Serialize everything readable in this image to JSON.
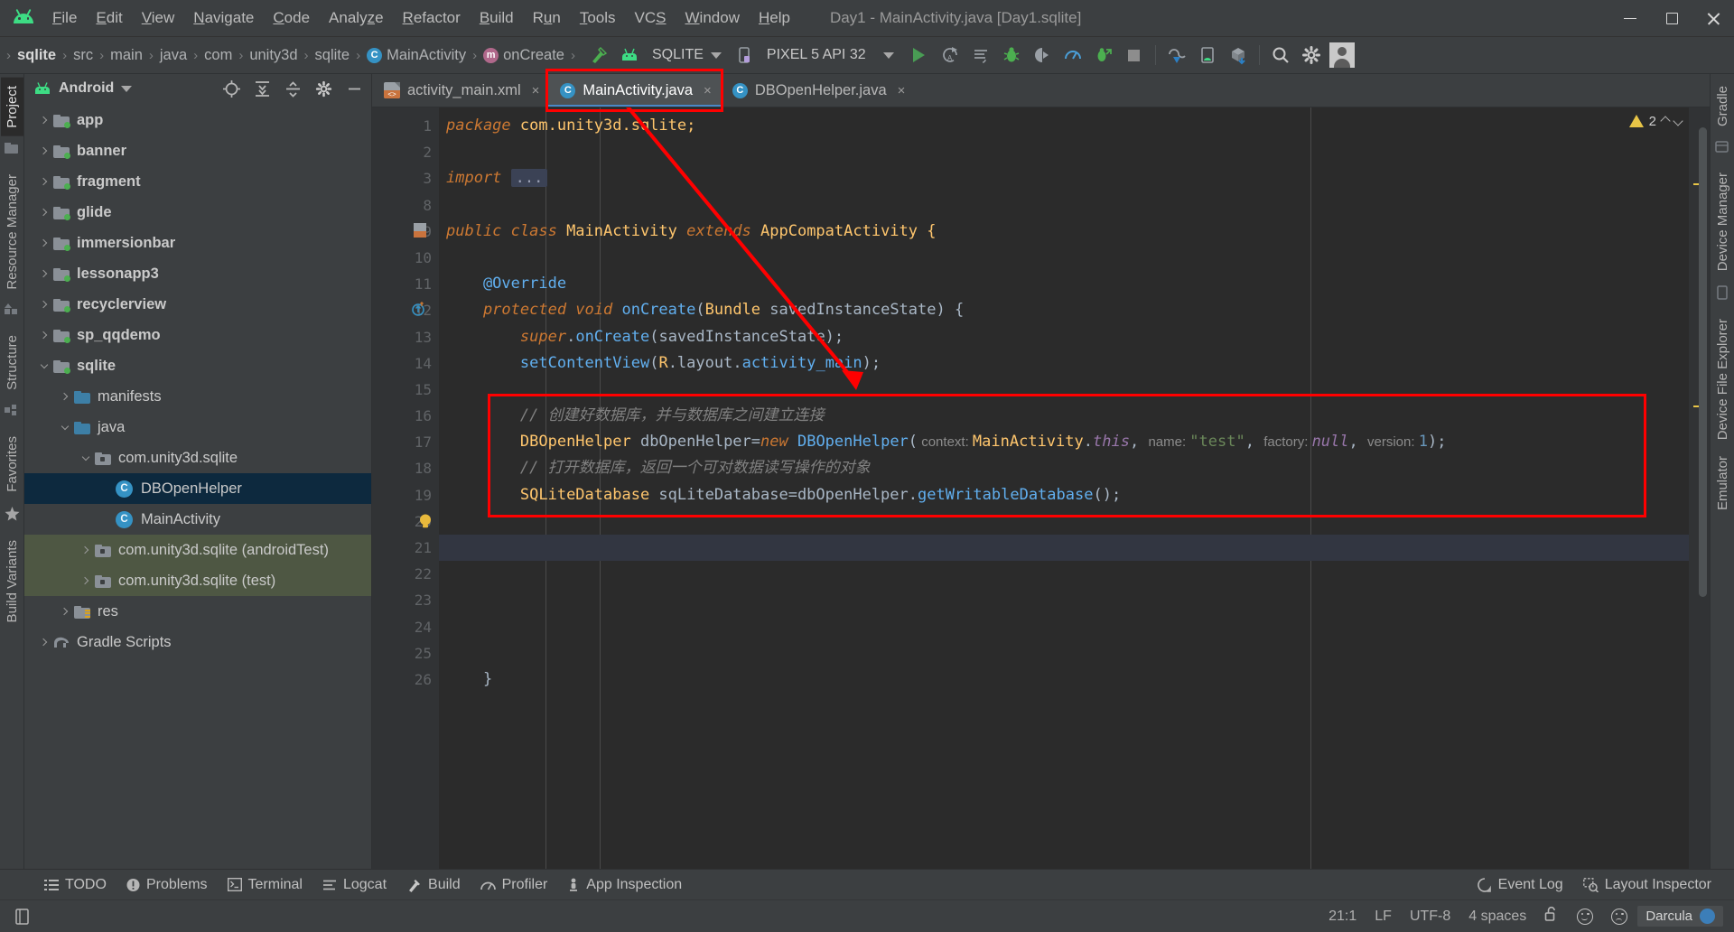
{
  "window": {
    "title": "Day1 - MainActivity.java [Day1.sqlite]",
    "logo": "android-logo-icon",
    "minimize": "minimize-button",
    "maximize": "maximize-button",
    "close": "close-button"
  },
  "menubar": [
    {
      "label": "File",
      "mnemonic": "F"
    },
    {
      "label": "Edit",
      "mnemonic": "E"
    },
    {
      "label": "View",
      "mnemonic": "V"
    },
    {
      "label": "Navigate",
      "mnemonic": "N"
    },
    {
      "label": "Code",
      "mnemonic": "C"
    },
    {
      "label": "Analyze",
      "mnemonic": "z"
    },
    {
      "label": "Refactor",
      "mnemonic": "R"
    },
    {
      "label": "Build",
      "mnemonic": "B"
    },
    {
      "label": "Run",
      "mnemonic": "u"
    },
    {
      "label": "Tools",
      "mnemonic": "T"
    },
    {
      "label": "VCS",
      "mnemonic": "S"
    },
    {
      "label": "Window",
      "mnemonic": "W"
    },
    {
      "label": "Help",
      "mnemonic": "H"
    }
  ],
  "breadcrumbs": [
    {
      "label": "sqlite",
      "bold": true,
      "icon": null
    },
    {
      "label": "src",
      "bold": false,
      "icon": null
    },
    {
      "label": "main",
      "bold": false,
      "icon": null
    },
    {
      "label": "java",
      "bold": false,
      "icon": null
    },
    {
      "label": "com",
      "bold": false,
      "icon": null
    },
    {
      "label": "unity3d",
      "bold": false,
      "icon": null
    },
    {
      "label": "sqlite",
      "bold": false,
      "icon": null
    },
    {
      "label": "MainActivity",
      "bold": false,
      "icon": "class-icon",
      "icon_letter": "C"
    },
    {
      "label": "onCreate",
      "bold": false,
      "icon": "method-icon",
      "icon_letter": "m"
    }
  ],
  "toolbar": {
    "build_icon": "build-hammer-icon",
    "run_config_icon": "android-app-icon",
    "run_config": "SQLITE",
    "device": "PIXEL 5 API 32",
    "device_icon": "phone-icon",
    "buttons": [
      {
        "name": "run-button",
        "icon": "play-icon"
      },
      {
        "name": "apply-changes-button",
        "icon": "apply-changes-icon"
      },
      {
        "name": "apply-code-changes-button",
        "icon": "apply-code-changes-icon"
      },
      {
        "name": "debug-button",
        "icon": "debug-bug-icon"
      },
      {
        "name": "attach-debugger-button",
        "icon": "attach-debugger-icon"
      },
      {
        "name": "profiler-button",
        "icon": "profiler-gauge-icon"
      },
      {
        "name": "run-with-coverage-button",
        "icon": "coverage-icon"
      },
      {
        "name": "stop-button",
        "icon": "stop-square-icon"
      },
      {
        "name": "avd-manager-button",
        "icon": "avd-manager-icon"
      },
      {
        "name": "sdk-manager-button",
        "icon": "sdk-manager-icon"
      },
      {
        "name": "gradle-sync-button",
        "icon": "gradle-sync-icon"
      },
      {
        "name": "search-everywhere-button",
        "icon": "search-icon"
      },
      {
        "name": "settings-button",
        "icon": "gear-icon"
      },
      {
        "name": "account-button",
        "icon": "avatar-icon"
      }
    ]
  },
  "left_strip": [
    {
      "label": "Project",
      "active": true
    },
    {
      "label": "Resource Manager",
      "active": false
    },
    {
      "label": "Structure",
      "active": false
    },
    {
      "label": "Favorites",
      "active": false
    },
    {
      "label": "Build Variants",
      "active": false
    }
  ],
  "right_strip": [
    {
      "label": "Gradle"
    },
    {
      "label": "Device Manager"
    },
    {
      "label": "Device File Explorer"
    },
    {
      "label": "Emulator"
    }
  ],
  "project_panel": {
    "title": "Android",
    "header_icons": [
      "locate-target-icon",
      "expand-all-icon",
      "collapse-all-icon",
      "settings-gear-icon",
      "hide-minus-icon"
    ],
    "tree": [
      {
        "label": "app",
        "indent": 0,
        "arrow": "closed",
        "icon": "module-folder",
        "bold": true,
        "state": "none"
      },
      {
        "label": "banner",
        "indent": 0,
        "arrow": "closed",
        "icon": "module-folder",
        "bold": true,
        "state": "none"
      },
      {
        "label": "fragment",
        "indent": 0,
        "arrow": "closed",
        "icon": "module-folder",
        "bold": true,
        "state": "none"
      },
      {
        "label": "glide",
        "indent": 0,
        "arrow": "closed",
        "icon": "module-folder",
        "bold": true,
        "state": "none"
      },
      {
        "label": "immersionbar",
        "indent": 0,
        "arrow": "closed",
        "icon": "module-folder",
        "bold": true,
        "state": "none"
      },
      {
        "label": "lessonapp3",
        "indent": 0,
        "arrow": "closed",
        "icon": "module-folder",
        "bold": true,
        "state": "none"
      },
      {
        "label": "recyclerview",
        "indent": 0,
        "arrow": "closed",
        "icon": "module-folder",
        "bold": true,
        "state": "none"
      },
      {
        "label": "sp_qqdemo",
        "indent": 0,
        "arrow": "closed",
        "icon": "module-folder",
        "bold": true,
        "state": "none"
      },
      {
        "label": "sqlite",
        "indent": 0,
        "arrow": "open",
        "icon": "module-folder",
        "bold": true,
        "state": "none"
      },
      {
        "label": "manifests",
        "indent": 1,
        "arrow": "closed",
        "icon": "blue-folder",
        "bold": false,
        "state": "none"
      },
      {
        "label": "java",
        "indent": 1,
        "arrow": "open",
        "icon": "blue-folder",
        "bold": false,
        "state": "none"
      },
      {
        "label": "com.unity3d.sqlite",
        "indent": 2,
        "arrow": "open",
        "icon": "package-folder",
        "bold": false,
        "state": "none"
      },
      {
        "label": "DBOpenHelper",
        "indent": 3,
        "arrow": "none",
        "icon": "java-class",
        "bold": false,
        "state": "selected"
      },
      {
        "label": "MainActivity",
        "indent": 3,
        "arrow": "none",
        "icon": "java-class",
        "bold": false,
        "state": "none"
      },
      {
        "label": "com.unity3d.sqlite (androidTest)",
        "indent": 2,
        "arrow": "closed",
        "icon": "package-folder",
        "bold": false,
        "state": "green"
      },
      {
        "label": "com.unity3d.sqlite (test)",
        "indent": 2,
        "arrow": "closed",
        "icon": "package-folder",
        "bold": false,
        "state": "green"
      },
      {
        "label": "res",
        "indent": 1,
        "arrow": "closed",
        "icon": "res-folder",
        "bold": false,
        "state": "none"
      },
      {
        "label": "Gradle Scripts",
        "indent": 0,
        "arrow": "closed",
        "icon": "gradle-icon",
        "bold": false,
        "state": "none"
      }
    ]
  },
  "editor": {
    "tabs": [
      {
        "label": "activity_main.xml",
        "icon": "xml-layout-icon",
        "active": false,
        "close": "×"
      },
      {
        "label": "MainActivity.java",
        "icon": "java-class-icon",
        "active": true,
        "close": "×"
      },
      {
        "label": "DBOpenHelper.java",
        "icon": "java-class-icon",
        "active": false,
        "close": "×"
      }
    ],
    "inspection": {
      "warning_count": "2",
      "icon": "warning-triangle-icon"
    },
    "line_numbers": [
      "1",
      "2",
      "3",
      "8",
      "9",
      "10",
      "11",
      "12",
      "13",
      "14",
      "15",
      "16",
      "17",
      "18",
      "19",
      "20",
      "21",
      "22",
      "23",
      "24",
      "25",
      "26"
    ],
    "caret_line_index": 16,
    "lines": [
      {
        "n": "1",
        "segments": [
          {
            "t": "package ",
            "c": "kw"
          },
          {
            "t": "com.unity3d.sqlite;",
            "c": "ty"
          }
        ]
      },
      {
        "n": "2",
        "segments": []
      },
      {
        "n": "3",
        "segments": [
          {
            "t": "import ",
            "c": "kw"
          },
          {
            "t": "...",
            "c": "fold"
          }
        ]
      },
      {
        "n": "8",
        "segments": []
      },
      {
        "n": "9",
        "segments": [
          {
            "t": "public class ",
            "c": "kw"
          },
          {
            "t": "MainActivity ",
            "c": "ty"
          },
          {
            "t": "extends ",
            "c": "kw"
          },
          {
            "t": "AppCompatActivity {",
            "c": "ty"
          }
        ],
        "gutter": "layout-preview-icon"
      },
      {
        "n": "10",
        "segments": []
      },
      {
        "n": "11",
        "segments": [
          {
            "t": "    @Override",
            "c": "fn"
          }
        ]
      },
      {
        "n": "12",
        "segments": [
          {
            "t": "    protected void ",
            "c": "kw"
          },
          {
            "t": "onCreate",
            "c": "fn"
          },
          {
            "t": "(",
            "c": "pl"
          },
          {
            "t": "Bundle ",
            "c": "ty"
          },
          {
            "t": "savedInstanceState",
            "c": "pl"
          },
          {
            "t": ") {",
            "c": "pl"
          }
        ],
        "gutter": "override-method-icon"
      },
      {
        "n": "13",
        "segments": [
          {
            "t": "        ",
            "c": "pl"
          },
          {
            "t": "super",
            "c": "kw"
          },
          {
            "t": ".",
            "c": "pl"
          },
          {
            "t": "onCreate",
            "c": "fn"
          },
          {
            "t": "(savedInstanceState);",
            "c": "pl"
          }
        ]
      },
      {
        "n": "14",
        "segments": [
          {
            "t": "        ",
            "c": "pl"
          },
          {
            "t": "setContentView",
            "c": "fn"
          },
          {
            "t": "(",
            "c": "pl"
          },
          {
            "t": "R",
            "c": "ty"
          },
          {
            "t": ".layout.",
            "c": "pl"
          },
          {
            "t": "activity_main",
            "c": "fn"
          },
          {
            "t": ");",
            "c": "pl"
          }
        ]
      },
      {
        "n": "15",
        "segments": []
      },
      {
        "n": "16",
        "segments": [
          {
            "t": "        // 创建好数据库，并与数据库之间建立连接",
            "c": "cm"
          }
        ]
      },
      {
        "n": "17",
        "segments": [
          {
            "t": "        ",
            "c": "pl"
          },
          {
            "t": "DBOpenHelper ",
            "c": "ty"
          },
          {
            "t": "dbOpenHelper=",
            "c": "pl"
          },
          {
            "t": "new ",
            "c": "kw"
          },
          {
            "t": "DBOpenHelper",
            "c": "fn"
          },
          {
            "t": "(",
            "c": "pl"
          },
          {
            "t": " context: ",
            "c": "hint"
          },
          {
            "t": "MainActivity",
            "c": "ty"
          },
          {
            "t": ".",
            "c": "pl"
          },
          {
            "t": "this",
            "c": "ky"
          },
          {
            "t": ", ",
            "c": "pl"
          },
          {
            "t": "name: ",
            "c": "hint"
          },
          {
            "t": "\"test\"",
            "c": "st"
          },
          {
            "t": ", ",
            "c": "pl"
          },
          {
            "t": "factory: ",
            "c": "hint"
          },
          {
            "t": "null",
            "c": "ky"
          },
          {
            "t": ", ",
            "c": "pl"
          },
          {
            "t": "version: ",
            "c": "hint"
          },
          {
            "t": "1",
            "c": "nm"
          },
          {
            "t": ");",
            "c": "pl"
          }
        ]
      },
      {
        "n": "18",
        "segments": [
          {
            "t": "        // 打开数据库，返回一个可对数据读写操作的对象",
            "c": "cm"
          }
        ]
      },
      {
        "n": "19",
        "segments": [
          {
            "t": "        ",
            "c": "pl"
          },
          {
            "t": "SQLiteDatabase ",
            "c": "ty"
          },
          {
            "t": "sqLiteDatabase=dbOpenHelper.",
            "c": "pl"
          },
          {
            "t": "getWritableDatabase",
            "c": "fn"
          },
          {
            "t": "();",
            "c": "pl"
          }
        ]
      },
      {
        "n": "20",
        "segments": [],
        "gutter": "intention-bulb-icon"
      },
      {
        "n": "21",
        "segments": [],
        "caret": true
      },
      {
        "n": "22",
        "segments": []
      },
      {
        "n": "23",
        "segments": []
      },
      {
        "n": "24",
        "segments": []
      },
      {
        "n": "25",
        "segments": []
      },
      {
        "n": "26",
        "segments": [
          {
            "t": "    }",
            "c": "pl"
          }
        ]
      }
    ]
  },
  "bottom_tools": {
    "left": [
      {
        "label": "TODO",
        "icon": "todo-list-icon"
      },
      {
        "label": "Problems",
        "icon": "problems-icon"
      },
      {
        "label": "Terminal",
        "icon": "terminal-icon"
      },
      {
        "label": "Logcat",
        "icon": "logcat-icon"
      },
      {
        "label": "Build",
        "icon": "build-hammer-icon"
      },
      {
        "label": "Profiler",
        "icon": "profiler-gauge-icon"
      },
      {
        "label": "App Inspection",
        "icon": "app-inspection-icon"
      }
    ],
    "right": [
      {
        "label": "Event Log",
        "icon": "event-log-icon"
      },
      {
        "label": "Layout Inspector",
        "icon": "layout-inspector-icon"
      }
    ]
  },
  "statusbar": {
    "position": "21:1",
    "line_separator": "LF",
    "encoding": "UTF-8",
    "indent": "4 spaces",
    "lock_icon": "unlocked-padlock-icon",
    "happy_icon": "happy-face-icon",
    "sad_icon": "sad-face-icon",
    "theme": "Darcula",
    "theme_dot_color": "#3c7eb8",
    "tool_toggle_icon": "show-tool-window-bars-icon"
  },
  "annotations": {
    "tab_highlight": "red-rectangle-around-mainactivity-tab",
    "code_highlight": "red-rectangle-around-db-code-block",
    "arrow": "red-arrow-from-tab-to-code-block",
    "color": "#ff0000"
  },
  "colors": {
    "chrome_bg": "#3c3f41",
    "editor_bg": "#2b2b2b",
    "gutter_bg": "#313335",
    "selection_blue": "#0d293e",
    "test_source_green": "#4e5743",
    "accent_blue": "#4a88c7",
    "android_green": "#3ddc84"
  }
}
